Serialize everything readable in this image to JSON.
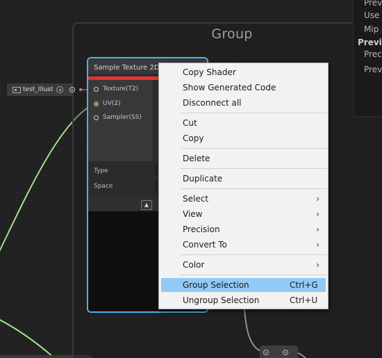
{
  "group": {
    "title": "Group"
  },
  "inspector": {
    "rows": [
      "Previ",
      "Use C",
      "Mip S"
    ],
    "section": "Previe",
    "sub_rows": [
      "Precis",
      "Previ"
    ]
  },
  "property_node": {
    "label": "test_Illust"
  },
  "node": {
    "title": "Sample Texture 2D",
    "inputs": [
      {
        "label": "Texture(T2)"
      },
      {
        "label": "UV(2)"
      },
      {
        "label": "Sampler(SS)"
      }
    ],
    "fields": [
      {
        "label": "Type"
      },
      {
        "label": "Space"
      }
    ],
    "collapse_icon": "chevron-up-icon"
  },
  "context_menu": {
    "items": [
      {
        "label": "Copy Shader"
      },
      {
        "label": "Show Generated Code"
      },
      {
        "label": "Disconnect all"
      },
      {
        "label": "Cut"
      },
      {
        "label": "Copy"
      },
      {
        "label": "Delete"
      },
      {
        "label": "Duplicate"
      },
      {
        "label": "Select",
        "submenu": true
      },
      {
        "label": "View",
        "submenu": true
      },
      {
        "label": "Precision",
        "submenu": true
      },
      {
        "label": "Convert To",
        "submenu": true
      },
      {
        "label": "Color",
        "submenu": true
      },
      {
        "label": "Group Selection",
        "shortcut": "Ctrl+G",
        "highlighted": true
      },
      {
        "label": "Ungroup Selection",
        "shortcut": "Ctrl+U"
      }
    ],
    "submenu_arrow": "›"
  },
  "colors": {
    "selection_outline": "#4fb0e8",
    "node_header_bar": "#e53232",
    "menu_highlight": "#91c9f7",
    "wire_green": "#9fe28b",
    "wire_pink": "#e3b7e3"
  }
}
